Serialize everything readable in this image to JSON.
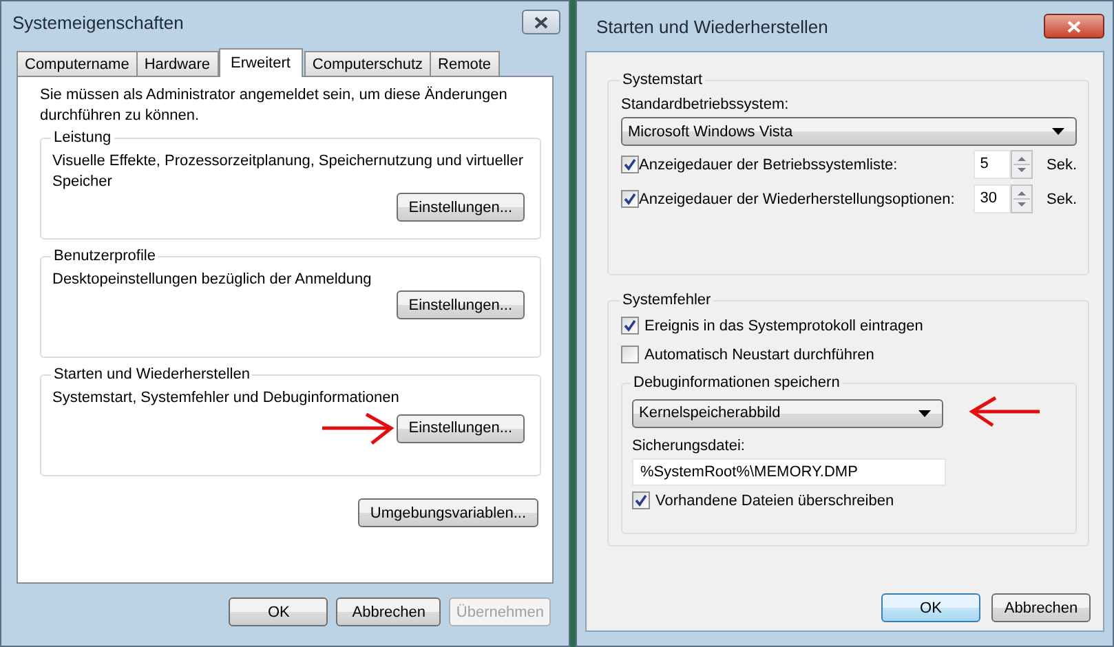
{
  "left_window": {
    "title": "Systemeigenschaften",
    "tabs": [
      {
        "label": "Computername",
        "selected": false
      },
      {
        "label": "Hardware",
        "selected": false
      },
      {
        "label": "Erweitert",
        "selected": true
      },
      {
        "label": "Computerschutz",
        "selected": false
      },
      {
        "label": "Remote",
        "selected": false
      }
    ],
    "notice": "Sie müssen als Administrator angemeldet sein, um diese Änderungen durchführen zu können.",
    "groups": [
      {
        "title": "Leistung",
        "description": "Visuelle Effekte, Prozessorzeitplanung, Speichernutzung und virtueller Speicher",
        "button": "Einstellungen...",
        "arrow": false
      },
      {
        "title": "Benutzerprofile",
        "description": "Desktopeinstellungen bezüglich der Anmeldung",
        "button": "Einstellungen...",
        "arrow": false
      },
      {
        "title": "Starten und Wiederherstellen",
        "description": "Systemstart, Systemfehler und Debuginformationen",
        "button": "Einstellungen...",
        "arrow": true
      }
    ],
    "env_button": "Umgebungsvariablen...",
    "buttons": [
      {
        "label": "OK",
        "disabled": false,
        "default": false
      },
      {
        "label": "Abbrechen",
        "disabled": false,
        "default": false
      },
      {
        "label": "Übernehmen",
        "disabled": true,
        "default": false
      }
    ]
  },
  "right_window": {
    "title": "Starten und Wiederherstellen",
    "systemstart": {
      "title": "Systemstart",
      "os_label": "Standardbetriebssystem:",
      "os_value": "Microsoft Windows Vista",
      "timeouts": [
        {
          "label": "Anzeigedauer der Betriebssystemliste:",
          "checked": true,
          "value": "5",
          "unit": "Sek."
        },
        {
          "label": "Anzeigedauer der Wiederherstellungsoptionen:",
          "checked": true,
          "value": "30",
          "unit": "Sek."
        }
      ]
    },
    "systemfehler": {
      "title": "Systemfehler",
      "options": [
        {
          "label": "Ereignis in das Systemprotokoll eintragen",
          "checked": true
        },
        {
          "label": "Automatisch Neustart durchführen",
          "checked": false
        }
      ],
      "debug": {
        "title": "Debuginformationen speichern",
        "dropdown": "Kernelspeicherabbild",
        "arrow": true,
        "file_label": "Sicherungsdatei:",
        "file_value": "%SystemRoot%\\MEMORY.DMP",
        "overwrite": {
          "label": "Vorhandene Dateien überschreiben",
          "checked": true
        }
      }
    },
    "buttons": [
      {
        "label": "OK",
        "disabled": false,
        "default": true
      },
      {
        "label": "Abbrechen",
        "disabled": false,
        "default": false
      }
    ]
  }
}
